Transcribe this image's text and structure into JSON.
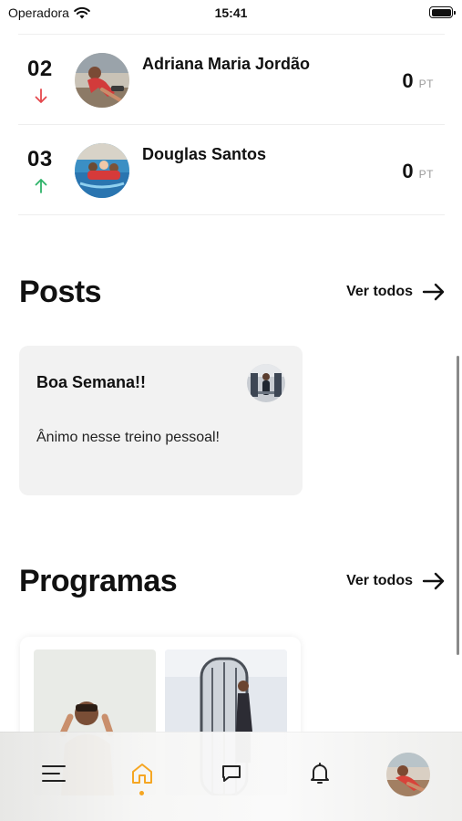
{
  "status_bar": {
    "carrier": "Operadora",
    "time": "15:41"
  },
  "ranking": [
    {
      "position": "02",
      "trend": "down",
      "name": "Adriana Maria Jordão",
      "points": "0",
      "unit": "PT"
    },
    {
      "position": "03",
      "trend": "up",
      "name": "Douglas Santos",
      "points": "0",
      "unit": "PT"
    }
  ],
  "colors": {
    "trend_down": "#e5484d",
    "trend_up": "#2fb36a",
    "active_tab": "#f5a623",
    "card_bg": "#f2f2f2"
  },
  "posts": {
    "title": "Posts",
    "see_all": "Ver todos",
    "items": [
      {
        "title": "Boa Semana!!",
        "body": "Ânimo nesse treino pessoal!"
      }
    ]
  },
  "programs": {
    "title": "Programas",
    "see_all": "Ver todos"
  },
  "tabbar": {
    "tabs": [
      {
        "name": "menu",
        "icon": "menu-icon",
        "active": false
      },
      {
        "name": "home",
        "icon": "home-icon",
        "active": true
      },
      {
        "name": "messages",
        "icon": "chat-bubble-icon",
        "active": false
      },
      {
        "name": "notifications",
        "icon": "bell-icon",
        "active": false
      },
      {
        "name": "profile",
        "icon": "user-avatar",
        "active": false
      }
    ]
  }
}
